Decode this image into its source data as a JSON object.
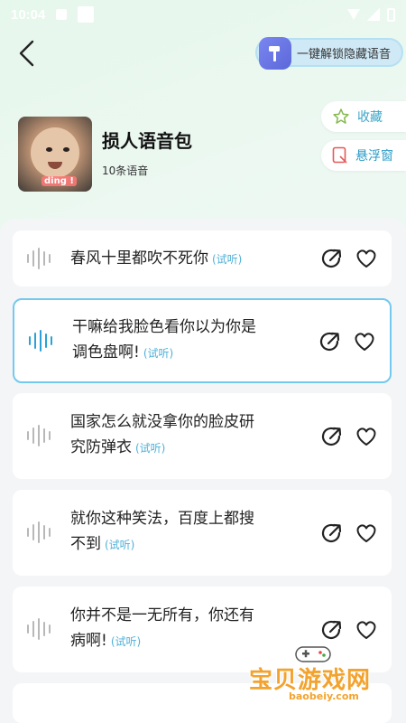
{
  "status_bar": {
    "time": "10:04"
  },
  "header": {
    "unlock_label": "一键解锁隐藏语音"
  },
  "pack": {
    "title": "损人语音包",
    "count": "10条语音",
    "avatar_caption": "ding !"
  },
  "side_actions": {
    "favorite_label": "收藏",
    "float_window_label": "悬浮窗"
  },
  "voices": [
    {
      "line1": "春风十里都吹不死你",
      "line2": "",
      "try_label": "(试听)",
      "active": false
    },
    {
      "line1": "干嘛给我脸色看你以为你是",
      "line2": "调色盘啊!",
      "try_label": "(试听)",
      "active": true
    },
    {
      "line1": "国家怎么就没拿你的脸皮研",
      "line2": "究防弹衣",
      "try_label": "(试听)",
      "active": false
    },
    {
      "line1": "就你这种笑法，百度上都搜",
      "line2": "不到",
      "try_label": "(试听)",
      "active": false
    },
    {
      "line1": "你并不是一无所有，你还有",
      "line2": "病啊!",
      "try_label": "(试听)",
      "active": false
    }
  ],
  "watermark": {
    "name": "宝贝游戏网",
    "url": "baobeiy.com"
  },
  "colors": {
    "accent": "#2aa2d6",
    "active_border": "#74c9ee",
    "unlock_bg": "#cfe9f6",
    "watermark": "#f3a32d"
  }
}
